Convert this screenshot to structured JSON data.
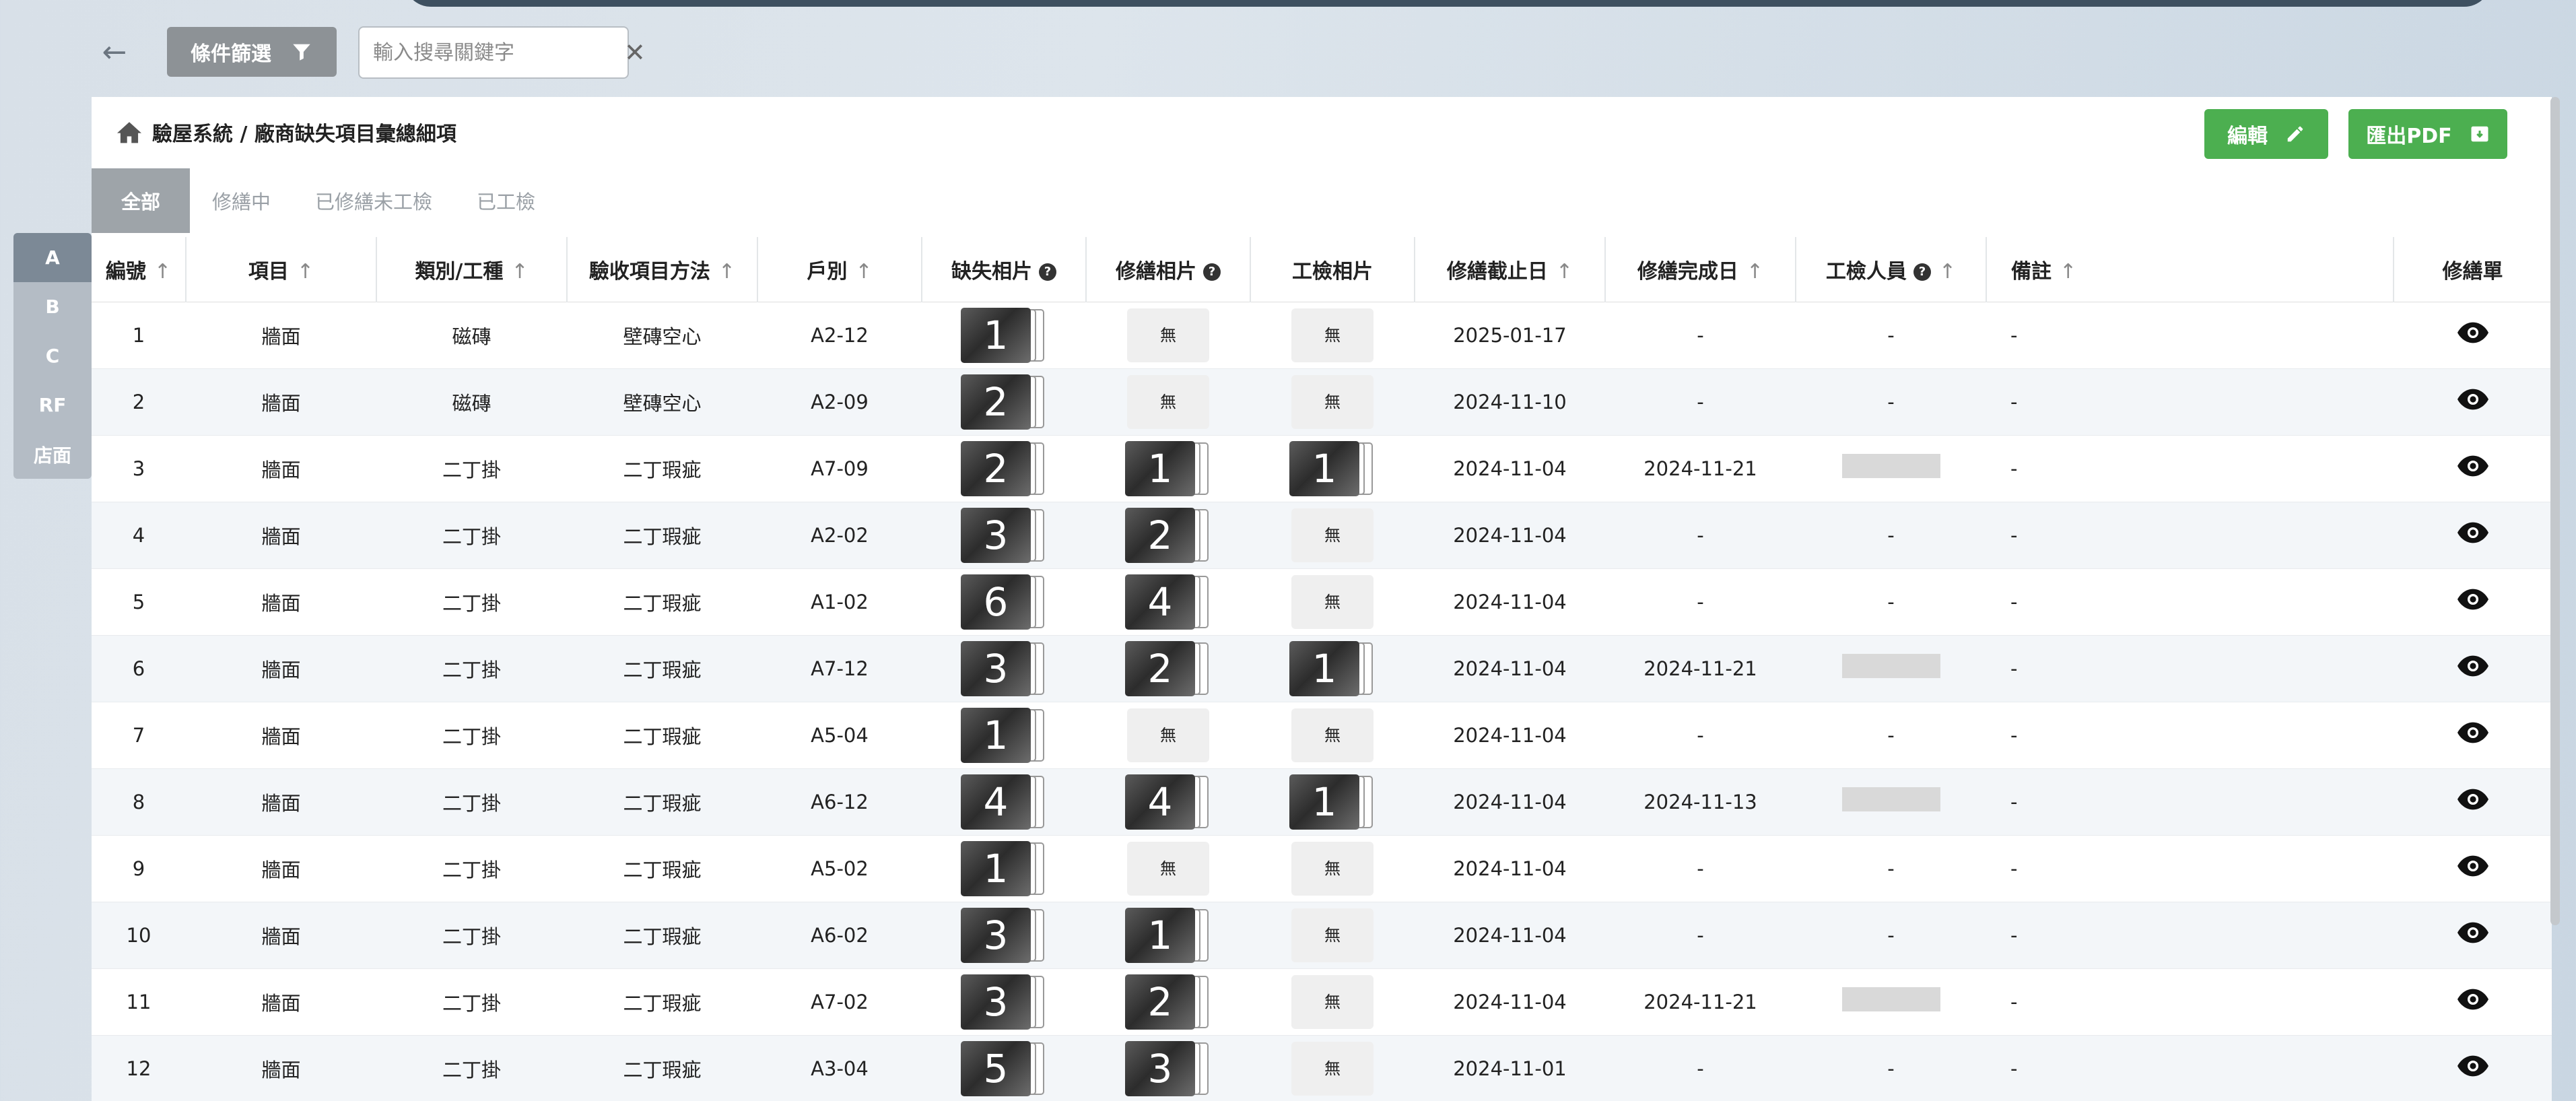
{
  "toolbar": {
    "filter_label": "條件篩選",
    "search_placeholder": "輸入搜尋關鍵字"
  },
  "side_tabs": [
    "A",
    "B",
    "C",
    "RF",
    "店面"
  ],
  "breadcrumb": "驗屋系統 / 廠商缺失項目彙總細項",
  "actions": {
    "edit_label": "編輯",
    "export_label": "匯出PDF"
  },
  "tabs": [
    "全部",
    "修繕中",
    "已修繕未工檢",
    "已工檢"
  ],
  "columns": [
    "編號",
    "項目",
    "類別/工種",
    "驗收項目方法",
    "戶別",
    "缺失相片",
    "修繕相片",
    "工檢相片",
    "修繕截止日",
    "修繕完成日",
    "工檢人員",
    "備註",
    "修繕單"
  ],
  "none_label": "無",
  "rows": [
    {
      "no": "1",
      "item": "牆面",
      "category": "磁磚",
      "method": "壁磚空心",
      "unit": "A2-12",
      "defect": "1",
      "repair": null,
      "inspect": null,
      "deadline": "2025-01-17",
      "done": "-",
      "inspector": "-",
      "note": "-"
    },
    {
      "no": "2",
      "item": "牆面",
      "category": "磁磚",
      "method": "壁磚空心",
      "unit": "A2-09",
      "defect": "2",
      "repair": null,
      "inspect": null,
      "deadline": "2024-11-10",
      "done": "-",
      "inspector": "-",
      "note": "-"
    },
    {
      "no": "3",
      "item": "牆面",
      "category": "二丁掛",
      "method": "二丁瑕疵",
      "unit": "A7-09",
      "defect": "2",
      "repair": "1",
      "inspect": "1",
      "deadline": "2024-11-04",
      "done": "2024-11-21",
      "inspector": null,
      "note": "-"
    },
    {
      "no": "4",
      "item": "牆面",
      "category": "二丁掛",
      "method": "二丁瑕疵",
      "unit": "A2-02",
      "defect": "3",
      "repair": "2",
      "inspect": null,
      "deadline": "2024-11-04",
      "done": "-",
      "inspector": "-",
      "note": "-"
    },
    {
      "no": "5",
      "item": "牆面",
      "category": "二丁掛",
      "method": "二丁瑕疵",
      "unit": "A1-02",
      "defect": "6",
      "repair": "4",
      "inspect": null,
      "deadline": "2024-11-04",
      "done": "-",
      "inspector": "-",
      "note": "-"
    },
    {
      "no": "6",
      "item": "牆面",
      "category": "二丁掛",
      "method": "二丁瑕疵",
      "unit": "A7-12",
      "defect": "3",
      "repair": "2",
      "inspect": "1",
      "deadline": "2024-11-04",
      "done": "2024-11-21",
      "inspector": null,
      "note": "-"
    },
    {
      "no": "7",
      "item": "牆面",
      "category": "二丁掛",
      "method": "二丁瑕疵",
      "unit": "A5-04",
      "defect": "1",
      "repair": null,
      "inspect": null,
      "deadline": "2024-11-04",
      "done": "-",
      "inspector": "-",
      "note": "-"
    },
    {
      "no": "8",
      "item": "牆面",
      "category": "二丁掛",
      "method": "二丁瑕疵",
      "unit": "A6-12",
      "defect": "4",
      "repair": "4",
      "inspect": "1",
      "deadline": "2024-11-04",
      "done": "2024-11-13",
      "inspector": null,
      "note": "-"
    },
    {
      "no": "9",
      "item": "牆面",
      "category": "二丁掛",
      "method": "二丁瑕疵",
      "unit": "A5-02",
      "defect": "1",
      "repair": null,
      "inspect": null,
      "deadline": "2024-11-04",
      "done": "-",
      "inspector": "-",
      "note": "-"
    },
    {
      "no": "10",
      "item": "牆面",
      "category": "二丁掛",
      "method": "二丁瑕疵",
      "unit": "A6-02",
      "defect": "3",
      "repair": "1",
      "inspect": null,
      "deadline": "2024-11-04",
      "done": "-",
      "inspector": "-",
      "note": "-"
    },
    {
      "no": "11",
      "item": "牆面",
      "category": "二丁掛",
      "method": "二丁瑕疵",
      "unit": "A7-02",
      "defect": "3",
      "repair": "2",
      "inspect": null,
      "deadline": "2024-11-04",
      "done": "2024-11-21",
      "inspector": null,
      "note": "-"
    },
    {
      "no": "12",
      "item": "牆面",
      "category": "二丁掛",
      "method": "二丁瑕疵",
      "unit": "A3-04",
      "defect": "5",
      "repair": "3",
      "inspect": null,
      "deadline": "2024-11-01",
      "done": "-",
      "inspector": "-",
      "note": "-"
    }
  ]
}
